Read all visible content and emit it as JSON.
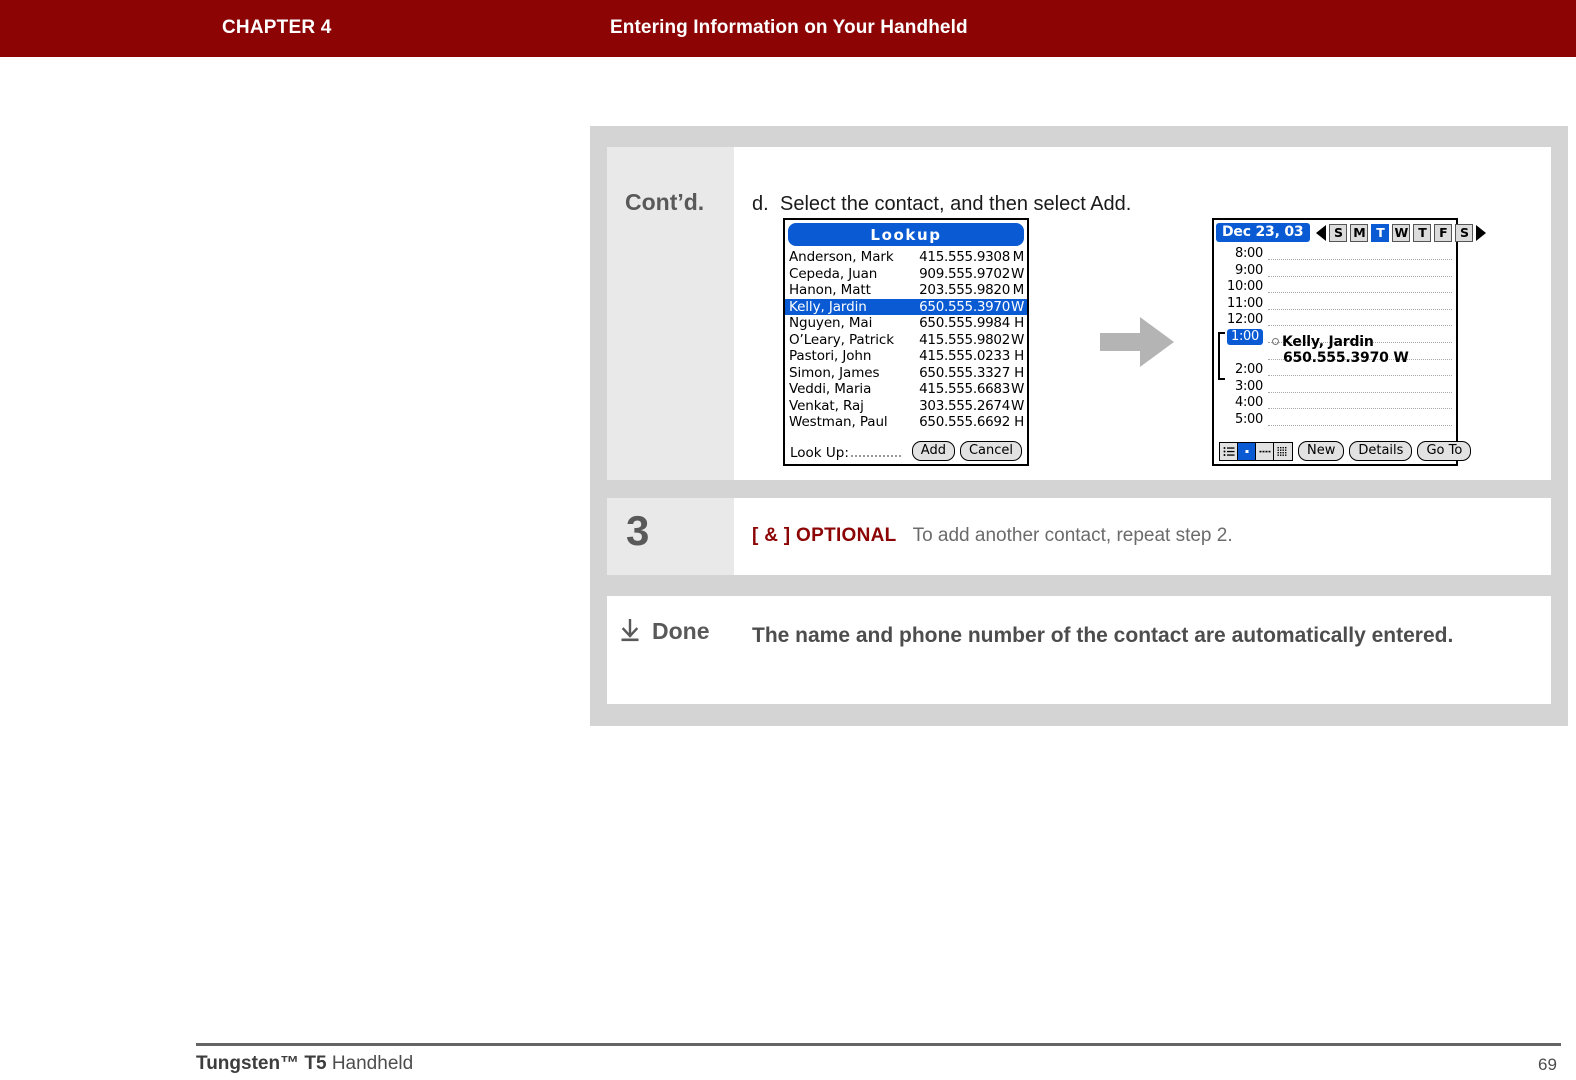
{
  "header": {
    "chapter": "CHAPTER 4",
    "title": "Entering Information on Your Handheld"
  },
  "steps": {
    "contd": {
      "label": "Cont’d.",
      "item_letter": "d.",
      "item_text": "Select the contact, and then select Add."
    },
    "step3": {
      "number": "3",
      "optional_tag": "[ & ]  OPTIONAL",
      "text": "To add another contact, repeat step 2."
    },
    "done": {
      "label": "Done",
      "icon": "download-arrow-icon",
      "text": "The name and phone number of the contact are automatically entered."
    }
  },
  "flow_arrow_icon": "arrow-right-icon",
  "lookup_screen": {
    "title": "Lookup",
    "contacts": [
      {
        "name": "Anderson, Mark",
        "phone": "415.555.9308",
        "type": "M",
        "selected": false
      },
      {
        "name": "Cepeda, Juan",
        "phone": "909.555.9702",
        "type": "W",
        "selected": false
      },
      {
        "name": "Hanon, Matt",
        "phone": "203.555.9820",
        "type": "M",
        "selected": false
      },
      {
        "name": "Kelly, Jardin",
        "phone": "650.555.3970",
        "type": "W",
        "selected": true
      },
      {
        "name": "Nguyen, Mai",
        "phone": "650.555.9984",
        "type": "H",
        "selected": false
      },
      {
        "name": "O’Leary, Patrick",
        "phone": "415.555.9802",
        "type": "W",
        "selected": false
      },
      {
        "name": "Pastori, John",
        "phone": "415.555.0233",
        "type": "H",
        "selected": false
      },
      {
        "name": "Simon, James",
        "phone": "650.555.3327",
        "type": "H",
        "selected": false
      },
      {
        "name": "Veddi, Maria",
        "phone": "415.555.6683",
        "type": "W",
        "selected": false
      },
      {
        "name": "Venkat, Raj",
        "phone": "303.555.2674",
        "type": "W",
        "selected": false
      },
      {
        "name": "Westman, Paul",
        "phone": "650.555.6692",
        "type": "H",
        "selected": false
      }
    ],
    "lookup_label": "Look Up:",
    "lookup_value": "",
    "add_button": "Add",
    "cancel_button": "Cancel"
  },
  "calendar_screen": {
    "date": "Dec 23, 03",
    "prev_icon": "triangle-left-icon",
    "next_icon": "triangle-right-icon",
    "weekdays": [
      {
        "letter": "S",
        "selected": false
      },
      {
        "letter": "M",
        "selected": false
      },
      {
        "letter": "T",
        "selected": true
      },
      {
        "letter": "W",
        "selected": false
      },
      {
        "letter": "T",
        "selected": false
      },
      {
        "letter": "F",
        "selected": false
      },
      {
        "letter": "S",
        "selected": false
      }
    ],
    "times": [
      {
        "label": "8:00",
        "selected": false
      },
      {
        "label": "9:00",
        "selected": false
      },
      {
        "label": "10:00",
        "selected": false
      },
      {
        "label": "11:00",
        "selected": false
      },
      {
        "label": "12:00",
        "selected": false
      },
      {
        "label": "1:00",
        "selected": true
      },
      {
        "label": "",
        "selected": false
      },
      {
        "label": "2:00",
        "selected": false
      },
      {
        "label": "3:00",
        "selected": false
      },
      {
        "label": "4:00",
        "selected": false
      },
      {
        "label": "5:00",
        "selected": false
      }
    ],
    "appointment": {
      "name": "Kelly, Jardin",
      "phone": "650.555.3970 W"
    },
    "view_icons": [
      {
        "name": "agenda-view-icon",
        "selected": false
      },
      {
        "name": "day-view-icon",
        "selected": true
      },
      {
        "name": "week-view-icon",
        "selected": false
      },
      {
        "name": "month-view-icon",
        "selected": false
      }
    ],
    "new_button": "New",
    "details_button": "Details",
    "goto_button": "Go To"
  },
  "footer": {
    "product_bold": "Tungsten™ T5",
    "product_rest": " Handheld",
    "page_number": "69"
  },
  "colors": {
    "header_red": "#8c0404",
    "optional_red": "#8c0404",
    "palm_blue": "#0a5bd3",
    "panel_gray": "#d4d4d4",
    "label_gray": "#e9e9e9"
  }
}
